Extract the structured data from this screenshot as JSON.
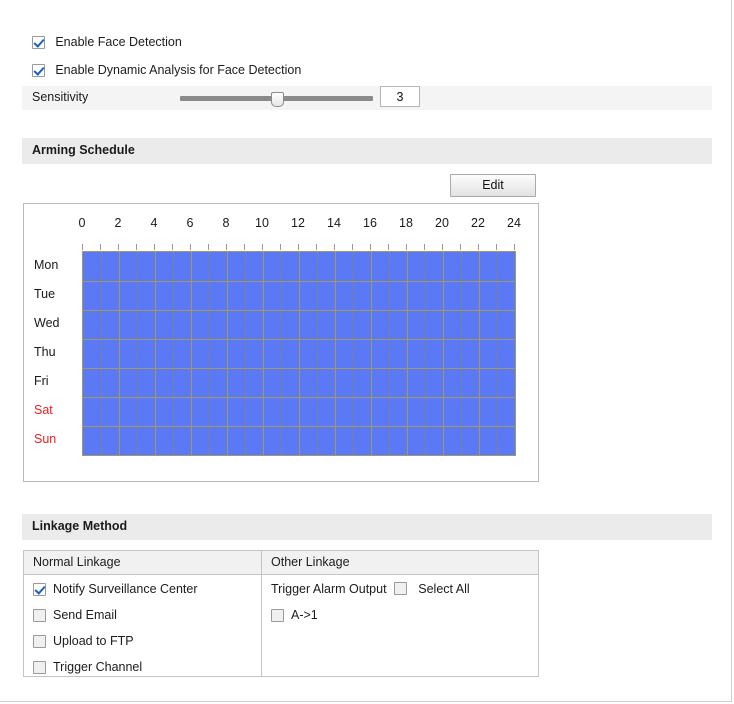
{
  "top_options": [
    {
      "name": "enable-face-detection",
      "label": "Enable Face Detection",
      "checked": true
    },
    {
      "name": "enable-dynamic-analysis",
      "label": "Enable Dynamic Analysis for Face Detection",
      "checked": true
    }
  ],
  "sensitivity": {
    "label": "Sensitivity",
    "value": "3",
    "min": 0,
    "max": 5,
    "handle_pct": 50
  },
  "arming_schedule": {
    "section_title": "Arming Schedule",
    "edit_label": "Edit",
    "hour_labels": [
      "0",
      "2",
      "4",
      "6",
      "8",
      "10",
      "12",
      "14",
      "16",
      "18",
      "20",
      "22",
      "24"
    ],
    "days": [
      {
        "label": "Mon",
        "weekend": false
      },
      {
        "label": "Tue",
        "weekend": false
      },
      {
        "label": "Wed",
        "weekend": false
      },
      {
        "label": "Thu",
        "weekend": false
      },
      {
        "label": "Fri",
        "weekend": false
      },
      {
        "label": "Sat",
        "weekend": true
      },
      {
        "label": "Sun",
        "weekend": true
      }
    ],
    "schedule_fill_color": "#5b78f5",
    "gridline_color": "#a5985f",
    "armed_ranges_per_day": [
      {
        "day": "Mon",
        "start": "00:00",
        "end": "24:00"
      },
      {
        "day": "Tue",
        "start": "00:00",
        "end": "24:00"
      },
      {
        "day": "Wed",
        "start": "00:00",
        "end": "24:00"
      },
      {
        "day": "Thu",
        "start": "00:00",
        "end": "24:00"
      },
      {
        "day": "Fri",
        "start": "00:00",
        "end": "24:00"
      },
      {
        "day": "Sat",
        "start": "00:00",
        "end": "24:00"
      },
      {
        "day": "Sun",
        "start": "00:00",
        "end": "24:00"
      }
    ]
  },
  "linkage": {
    "section_title": "Linkage Method",
    "col1_header": "Normal Linkage",
    "col2_header": "Other Linkage",
    "normal_items": [
      {
        "name": "notify-surveillance-center",
        "label": "Notify Surveillance Center",
        "checked": true
      },
      {
        "name": "send-email",
        "label": "Send Email",
        "checked": false
      },
      {
        "name": "upload-to-ftp",
        "label": "Upload to FTP",
        "checked": false
      },
      {
        "name": "trigger-channel",
        "label": "Trigger Channel",
        "checked": false
      }
    ],
    "trigger_alarm_output_label": "Trigger Alarm Output",
    "select_all_label": "Select All",
    "select_all_checked": false,
    "alarm_outputs": [
      {
        "name": "alarm-output-a-1",
        "label": "A->1",
        "checked": false
      }
    ]
  }
}
